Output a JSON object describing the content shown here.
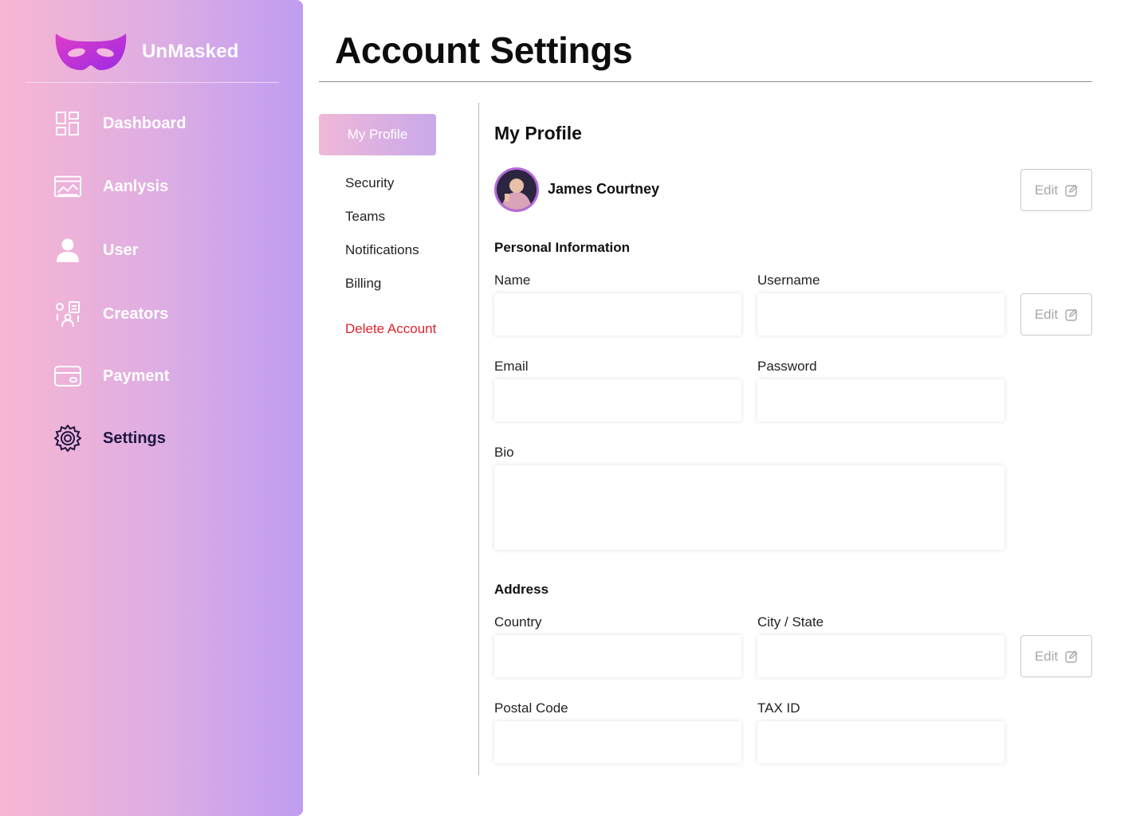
{
  "brand": {
    "name": "UnMasked",
    "logo_icon": "mask-icon",
    "logo_color": "#c32ee0"
  },
  "sidebar": {
    "items": [
      {
        "label": "Dashboard",
        "icon": "dashboard-grid-icon",
        "active": false
      },
      {
        "label": "Aanlysis",
        "icon": "analysis-chart-icon",
        "active": false
      },
      {
        "label": "User",
        "icon": "user-icon",
        "active": false
      },
      {
        "label": "Creators",
        "icon": "creators-icon",
        "active": false
      },
      {
        "label": "Payment",
        "icon": "card-icon",
        "active": false
      },
      {
        "label": "Settings",
        "icon": "gear-icon",
        "active": true
      }
    ]
  },
  "header": {
    "title": "Account Settings"
  },
  "settings_nav": {
    "active": "My Profile",
    "items": [
      "Security",
      "Teams",
      "Notifications",
      "Billing"
    ],
    "danger": "Delete Account"
  },
  "profile": {
    "section_title": "My Profile",
    "name": "James Courtney",
    "edit_label": "Edit"
  },
  "personal_info": {
    "title": "Personal Information",
    "name_label": "Name",
    "username_label": "Username",
    "email_label": "Email",
    "password_label": "Password",
    "bio_label": "Bio",
    "name_value": "",
    "username_value": "",
    "email_value": "",
    "password_value": "",
    "bio_value": "",
    "edit_label": "Edit"
  },
  "address": {
    "title": "Address",
    "country_label": "Country",
    "city_label": "City / State",
    "postal_label": "Postal Code",
    "tax_label": "TAX ID",
    "country_value": "",
    "city_value": "",
    "postal_value": "",
    "tax_value": "",
    "edit_label": "Edit"
  },
  "colors": {
    "sidebar_gradient_start": "#f8b6d2",
    "sidebar_gradient_end": "#c09df2",
    "danger": "#e0232f",
    "active_nav_text": "#1d1640"
  }
}
